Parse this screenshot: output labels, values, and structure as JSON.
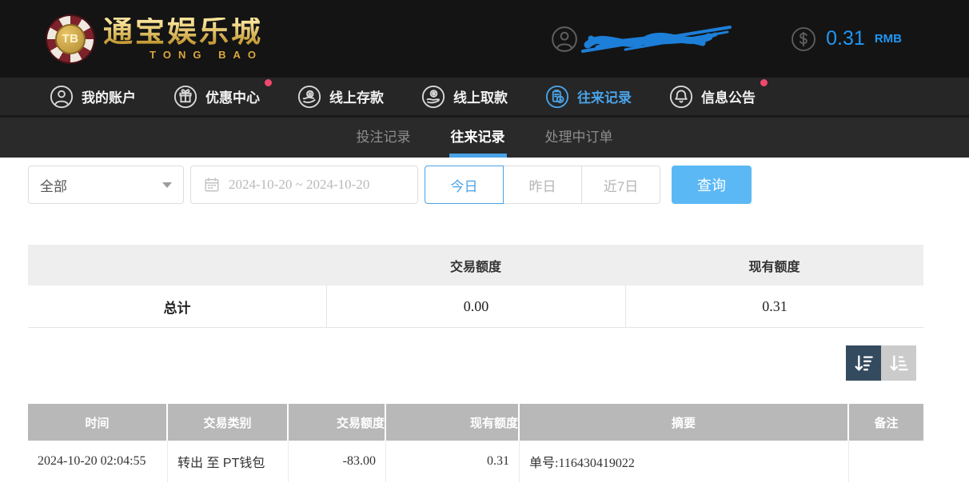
{
  "colors": {
    "accent_blue": "#4aa3e8",
    "balance_blue": "#2196f3",
    "query_button_blue": "#5bb8f5",
    "notification_dot_red": "#f0486c",
    "sort_active_bg": "#344a5e",
    "table_header_gray": "#b8b8b8"
  },
  "header": {
    "logo": {
      "chip_label": "TB",
      "title": "通宝娱乐城",
      "subtitle": "TONG BAO"
    },
    "balance": {
      "amount": "0.31",
      "currency": "RMB"
    }
  },
  "nav": {
    "items": [
      {
        "label": "我的账户",
        "icon": "user-circle-icon",
        "active": false,
        "badge": false
      },
      {
        "label": "优惠中心",
        "icon": "gift-icon",
        "active": false,
        "badge": true
      },
      {
        "label": "线上存款",
        "icon": "deposit-hand-coin-icon",
        "active": false,
        "badge": false
      },
      {
        "label": "线上取款",
        "icon": "withdraw-hand-money-icon",
        "active": false,
        "badge": false
      },
      {
        "label": "往来记录",
        "icon": "records-clipboard-clock-icon",
        "active": true,
        "badge": false
      },
      {
        "label": "信息公告",
        "icon": "bell-icon",
        "active": false,
        "badge": true
      }
    ]
  },
  "subnav": {
    "tabs": [
      {
        "label": "投注记录",
        "active": false
      },
      {
        "label": "往来记录",
        "active": true
      },
      {
        "label": "处理中订单",
        "active": false
      }
    ]
  },
  "filters": {
    "category_select": {
      "value": "全部"
    },
    "date_range": {
      "icon": "calendar-icon",
      "value": "2024-10-20 ~ 2024-10-20"
    },
    "quick_ranges": [
      {
        "label": "今日",
        "active": true
      },
      {
        "label": "昨日",
        "active": false
      },
      {
        "label": "近7日",
        "active": false
      }
    ],
    "query_button": "查询"
  },
  "summary": {
    "headers": {
      "transaction": "交易额度",
      "current": "现有额度"
    },
    "row_label": "总计",
    "transaction_total": "0.00",
    "current_total": "0.31"
  },
  "sort": {
    "buttons": [
      {
        "icon": "sort-descending-icon",
        "active": true
      },
      {
        "icon": "sort-ascending-icon",
        "active": false
      }
    ]
  },
  "table": {
    "columns": {
      "time": "时间",
      "category": "交易类别",
      "amount": "交易额度",
      "balance": "现有额度",
      "summary": "摘要",
      "note": "备注"
    },
    "rows": [
      {
        "time": "2024-10-20 02:04:55",
        "category": "转出 至 PT钱包",
        "amount": "-83.00",
        "balance": "0.31",
        "summary": "单号:116430419022",
        "note": ""
      }
    ]
  }
}
